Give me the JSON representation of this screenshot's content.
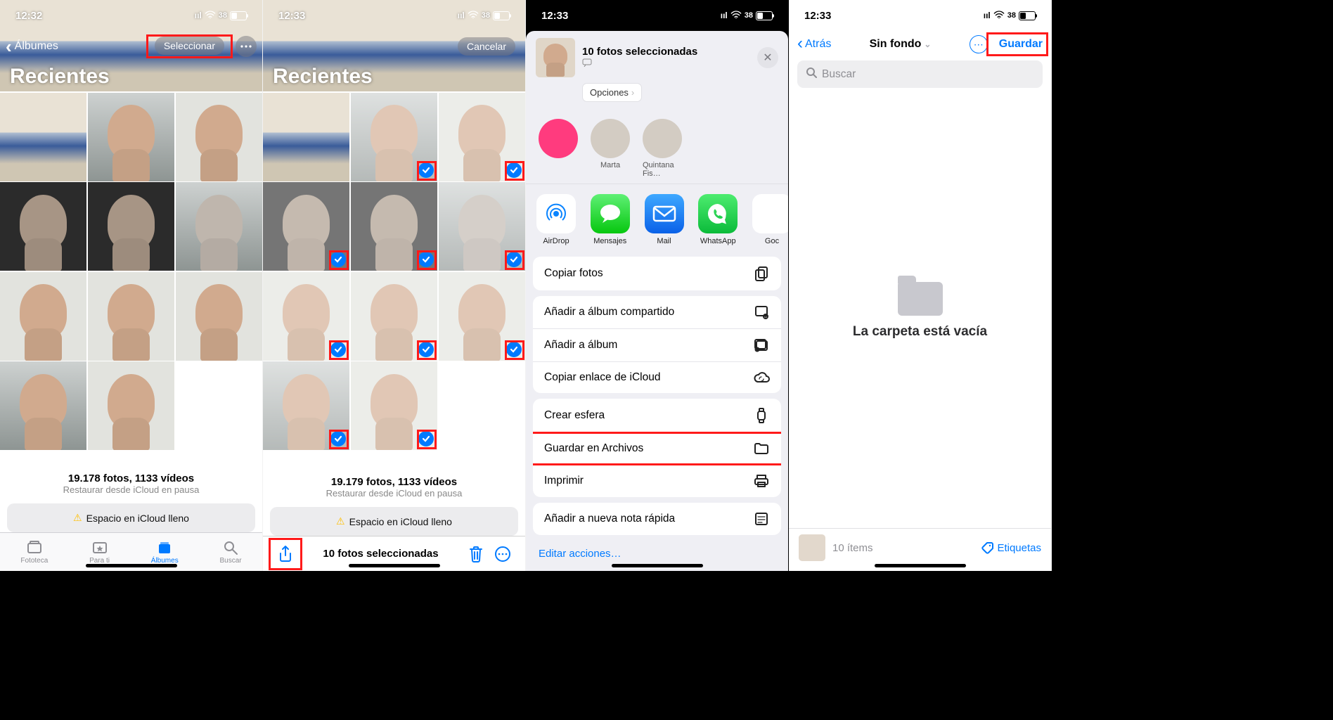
{
  "status": {
    "time1": "12:32",
    "time2": "12:33",
    "battery": "38",
    "signal": "•ıll"
  },
  "s1": {
    "backLabel": "Álbumes",
    "title": "Recientes",
    "selectBtn": "Seleccionar",
    "photosLine": "19.178 fotos, 1133 vídeos",
    "restoreLine": "Restaurar desde iCloud en pausa",
    "banner": "Espacio en iCloud lleno",
    "tabs": {
      "fototeca": "Fototeca",
      "parati": "Para ti",
      "albumes": "Álbumes",
      "buscar": "Buscar"
    }
  },
  "s2": {
    "cancelBtn": "Cancelar",
    "title": "Recientes",
    "photosLine": "19.179 fotos, 1133 vídeos",
    "restoreLine": "Restaurar desde iCloud en pausa",
    "banner": "Espacio en iCloud lleno",
    "selectedLine": "10 fotos seleccionadas"
  },
  "s3": {
    "title": "10 fotos seleccionadas",
    "optionsBtn": "Opciones",
    "contacts": [
      "",
      "Marta",
      "Quintana Fis…"
    ],
    "apps": {
      "airdrop": "AirDrop",
      "mensajes": "Mensajes",
      "mail": "Mail",
      "whatsapp": "WhatsApp",
      "goc": "Goc"
    },
    "actions": {
      "copiar": "Copiar fotos",
      "compartido": "Añadir a álbum compartido",
      "album": "Añadir a álbum",
      "icloud": "Copiar enlace de iCloud",
      "esfera": "Crear esfera",
      "archivos": "Guardar en Archivos",
      "imprimir": "Imprimir",
      "nota": "Añadir a nueva nota rápida"
    },
    "editLink": "Editar acciones…"
  },
  "s4": {
    "backLabel": "Atrás",
    "title": "Sin fondo",
    "saveBtn": "Guardar",
    "searchPh": "Buscar",
    "emptyText": "La carpeta está vacía",
    "itemsCount": "10 ítems",
    "tagsLabel": "Etiquetas"
  }
}
